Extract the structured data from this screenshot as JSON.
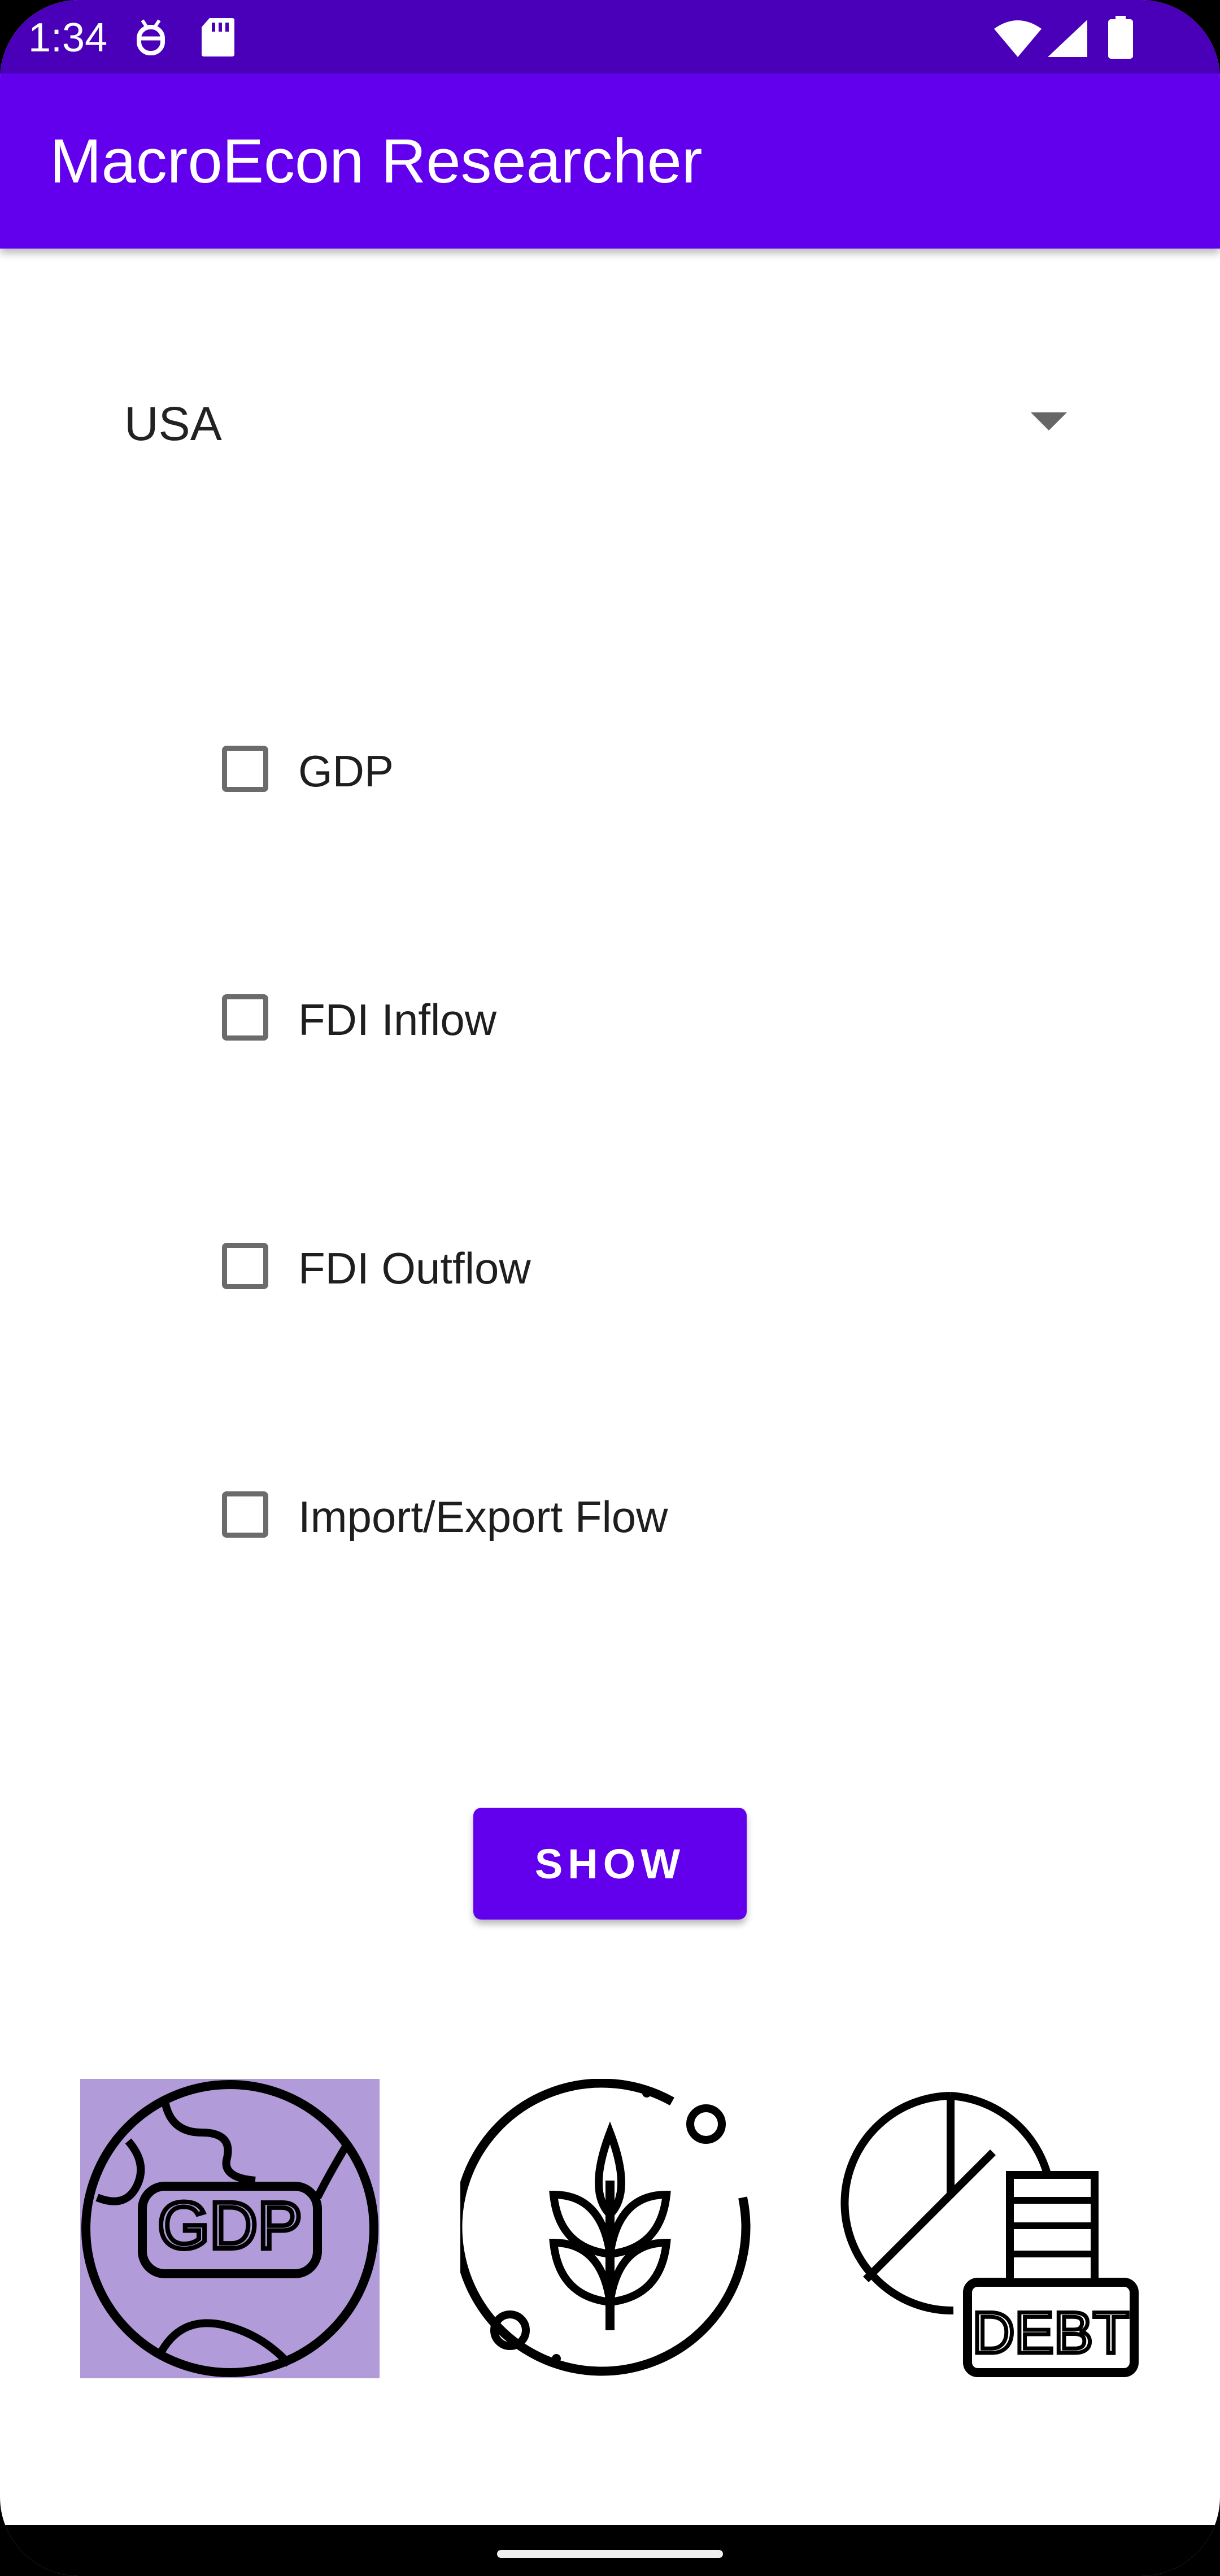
{
  "status_bar": {
    "time": "1:34",
    "icons": [
      "bug-icon",
      "sd-card-icon",
      "wifi-icon",
      "signal-icon",
      "battery-icon"
    ]
  },
  "app_bar": {
    "title": "MacroEcon Researcher"
  },
  "country_spinner": {
    "selected": "USA"
  },
  "indicators": [
    {
      "label": "GDP",
      "checked": false
    },
    {
      "label": "FDI Inflow",
      "checked": false
    },
    {
      "label": "FDI Outflow",
      "checked": false
    },
    {
      "label": "Import/Export Flow",
      "checked": false
    }
  ],
  "show_button": {
    "label": "SHOW"
  },
  "tiles": [
    {
      "icon": "gdp-globe-icon",
      "label": "GDP",
      "selected": true
    },
    {
      "icon": "agriculture-wheat-icon",
      "selected": false
    },
    {
      "icon": "debt-chart-icon",
      "label": "DEBT",
      "selected": false
    }
  ],
  "colors": {
    "status_bar": "#4a00b8",
    "app_bar": "#6200ee",
    "accent": "#6200ee",
    "selected_tile_bg": "#b19cd9"
  }
}
